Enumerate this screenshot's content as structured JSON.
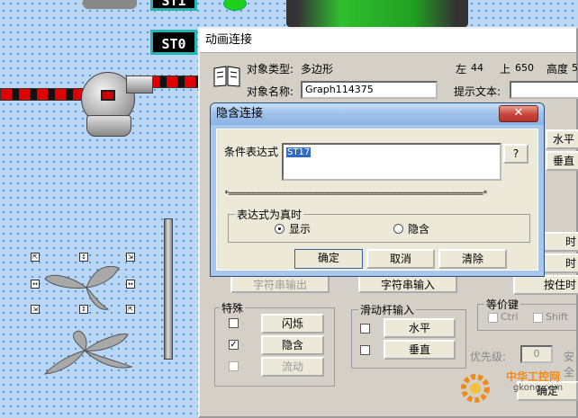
{
  "canvas": {
    "tag_st0": "ST0",
    "tag_top": "ST1"
  },
  "main_dialog": {
    "title": "动画连接",
    "object_type_label": "对象类型:",
    "object_type_value": "多边形",
    "left_label": "左",
    "left_value": "44",
    "top_label": "上",
    "top_value": "650",
    "height_label": "高度",
    "height_value": "5",
    "object_name_label": "对象名称:",
    "object_name_value": "Graph114375",
    "hint_label": "提示文本:",
    "hint_value": "",
    "right_buttons": [
      "水平",
      "垂直"
    ],
    "right_buttons2": [
      "时",
      "时",
      "按住时"
    ],
    "string_output_btn": "字符串输出",
    "string_input_btn": "字符串输入",
    "special_group": {
      "title": "特殊",
      "items": [
        {
          "label": "闪烁",
          "checked": false,
          "enabled": true
        },
        {
          "label": "隐含",
          "checked": true,
          "enabled": true
        },
        {
          "label": "流动",
          "checked": false,
          "enabled": false
        }
      ]
    },
    "slider_group": {
      "title": "滑动杆输入",
      "items": [
        {
          "label": "水平",
          "checked": false
        },
        {
          "label": "垂直",
          "checked": false
        }
      ]
    },
    "equiv_key": {
      "title": "等价键",
      "ctrl": "Ctrl",
      "shift": "Shift"
    },
    "priority_label": "优先级:",
    "priority_value": "0",
    "security_label": "安全",
    "ok_button": "确定"
  },
  "hidden_dialog": {
    "title": "隐含连接",
    "close": "✕",
    "condition_label": "条件表达式",
    "condition_value": "ST17",
    "browse_button": "?",
    "divider": "*================================================================*",
    "group_title": "表达式为真时",
    "radio_show": "显示",
    "radio_hide": "隐含",
    "selected": "显示",
    "ok": "确定",
    "cancel": "取消",
    "clear": "清除"
  },
  "watermark": {
    "brand": "中华工控网",
    "url": "gkong.com"
  }
}
